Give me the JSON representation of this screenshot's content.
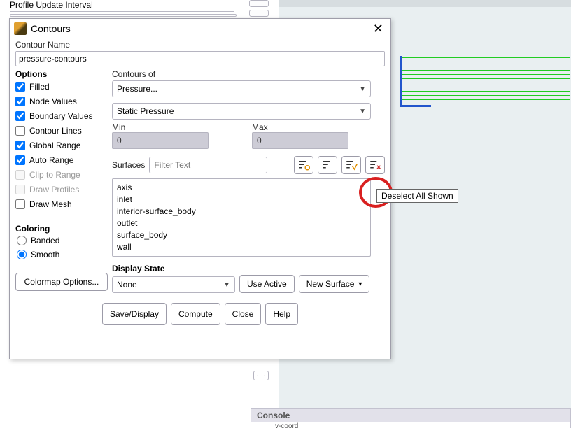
{
  "bg": {
    "profile_label": "Profile Update Interval",
    "console_title": "Console",
    "console_line": "v-coord"
  },
  "dialog": {
    "title": "Contours",
    "contour_name_label": "Contour Name",
    "contour_name_value": "pressure-contours",
    "options_header": "Options",
    "options": {
      "filled": "Filled",
      "node_values": "Node Values",
      "boundary_values": "Boundary Values",
      "contour_lines": "Contour Lines",
      "global_range": "Global Range",
      "auto_range": "Auto Range",
      "clip_to_range": "Clip to Range",
      "draw_profiles": "Draw Profiles",
      "draw_mesh": "Draw Mesh"
    },
    "coloring_header": "Coloring",
    "coloring": {
      "banded": "Banded",
      "smooth": "Smooth"
    },
    "colormap_btn": "Colormap Options...",
    "contours_of_label": "Contours of",
    "contours_of_value": "Pressure...",
    "subvar_value": "Static Pressure",
    "min_label": "Min",
    "max_label": "Max",
    "min_value": "0",
    "max_value": "0",
    "surfaces_label": "Surfaces",
    "filter_placeholder": "Filter Text",
    "surface_items": [
      "axis",
      "inlet",
      "interior-surface_body",
      "outlet",
      "surface_body",
      "wall"
    ],
    "display_state_label": "Display State",
    "display_state_value": "None",
    "use_active_btn": "Use Active",
    "new_surface_btn": "New Surface",
    "save_display_btn": "Save/Display",
    "compute_btn": "Compute",
    "close_btn": "Close",
    "help_btn": "Help",
    "tooltip": "Deselect All Shown"
  }
}
